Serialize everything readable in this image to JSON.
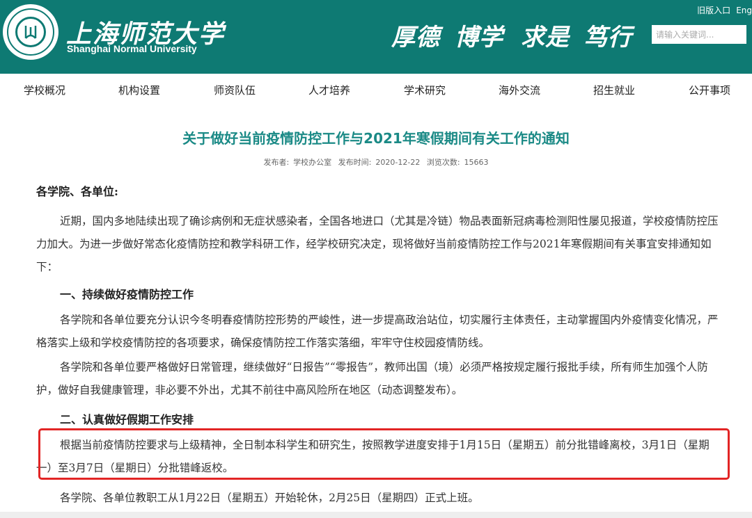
{
  "header": {
    "logo_cn": "上海师范大学",
    "logo_en": "Shanghai Normal University",
    "motto": [
      "厚德",
      "博学",
      "求是",
      "笃行"
    ],
    "links": [
      "旧版入口",
      "Eng"
    ],
    "search_placeholder": "请输入关键词...",
    "brand_color": "#0e7a73"
  },
  "nav": {
    "items": [
      "学校概况",
      "机构设置",
      "师资队伍",
      "人才培养",
      "学术研究",
      "海外交流",
      "招生就业",
      "公开事项"
    ]
  },
  "article": {
    "title": "关于做好当前疫情防控工作与2021年寒假期间有关工作的通知",
    "meta": {
      "publisher_label": "发布者:",
      "publisher": "学校办公室",
      "time_label": "发布时间:",
      "time": "2020-12-22",
      "views_label": "浏览次数:",
      "views": "15663"
    },
    "greeting": "各学院、各单位:",
    "p1": "近期，国内多地陆续出现了确诊病例和无症状感染者，全国各地进口（尤其是冷链）物品表面新冠病毒检测阳性屡见报道，学校疫情防控压力加大。为进一步做好常态化疫情防控和教学科研工作，经学校研究决定，现将做好当前疫情防控工作与2021年寒假期间有关事宜安排通知如下：",
    "h1": "一、持续做好疫情防控工作",
    "p2": "各学院和各单位要充分认识今冬明春疫情防控形势的严峻性，进一步提高政治站位，切实履行主体责任，主动掌握国内外疫情变化情况，严格落实上级和学校疫情防控的各项要求，确保疫情防控工作落实落细，牢牢守住校园疫情防线。",
    "p3": "各学院和各单位要严格做好日常管理，继续做好“日报告”“零报告”，教师出国（境）必须严格按规定履行报批手续，所有师生加强个人防护，做好自我健康管理，非必要不外出，尤其不前往中高风险所在地区（动态调整发布）。",
    "h2": "二、认真做好假期工作安排",
    "p4": "根据当前疫情防控要求与上级精神，全日制本科学生和研究生，按照教学进度安排于1月15日（星期五）前分批错峰离校，3月1日（星期一）至3月7日（星期日）分批错峰返校。",
    "p5": "各学院、各单位教职工从1月22日（星期五）开始轮休，2月25日（星期四）正式上班。",
    "title_color": "#1b8a86",
    "highlight_color": "#e22525"
  }
}
